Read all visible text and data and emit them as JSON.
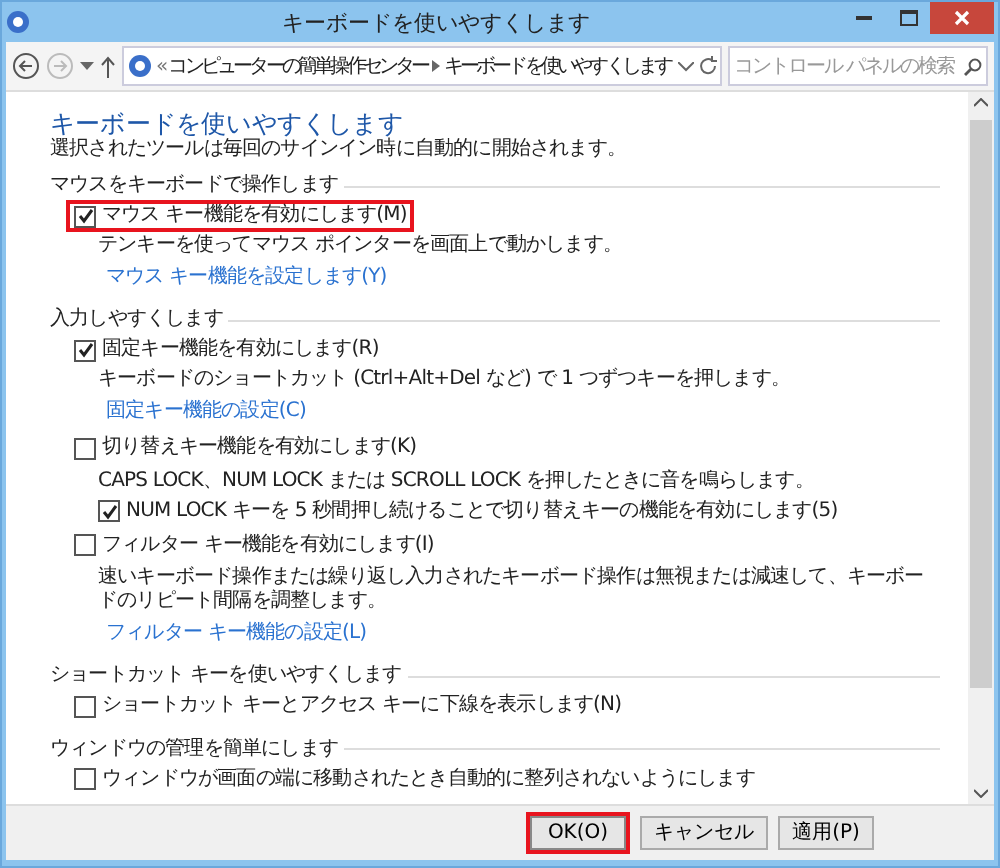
{
  "window": {
    "title": "キーボードを使いやすくします"
  },
  "address_bar": {
    "separator": "«",
    "crumbs": [
      "コンピューターの簡単操作センター",
      "キーボードを使いやすくします"
    ]
  },
  "search": {
    "placeholder": "コントロール パネルの検索"
  },
  "heading": "キーボードを使いやすくします",
  "subtitle": "選択されたツールは毎回のサインイン時に自動的に開始されます。",
  "sections": [
    {
      "title": "マウスをキーボードで操作します",
      "items": [
        {
          "label": "マウス キー機能を有効にします(M)",
          "checked": true,
          "highlighted": true,
          "description": "テンキーを使ってマウス ポインターを画面上で動かします。",
          "link": "マウス キー機能を設定します(Y)"
        }
      ]
    },
    {
      "title": "入力しやすくします",
      "items": [
        {
          "label": "固定キー機能を有効にします(R)",
          "checked": true,
          "highlighted": false,
          "description": "キーボードのショートカット (Ctrl+Alt+Del など) で 1 つずつキーを押します。",
          "link": "固定キー機能の設定(C)"
        },
        {
          "label": "切り替えキー機能を有効にします(K)",
          "checked": false,
          "highlighted": false,
          "description": "CAPS LOCK、NUM LOCK または SCROLL LOCK を押したときに音を鳴らします。",
          "children": [
            {
              "label": "NUM LOCK キーを 5 秒間押し続けることで切り替えキーの機能を有効にします(5)",
              "checked": true,
              "highlighted": false
            }
          ]
        },
        {
          "label": "フィルター キー機能を有効にします(I)",
          "checked": false,
          "highlighted": false,
          "description": "速いキーボード操作または繰り返し入力されたキーボード操作は無視または減速して、キーボードのリピート間隔を調整します。",
          "link": "フィルター キー機能の設定(L)"
        }
      ]
    },
    {
      "title": "ショートカット キーを使いやすくします",
      "items": [
        {
          "label": "ショートカット キーとアクセス キーに下線を表示します(N)",
          "checked": false,
          "highlighted": false
        }
      ]
    },
    {
      "title": "ウィンドウの管理を簡単にします",
      "items": [
        {
          "label": "ウィンドウが画面の端に移動されたとき自動的に整列されないようにします",
          "checked": false,
          "highlighted": false
        }
      ]
    }
  ],
  "buttons": [
    {
      "label": "OK(O)",
      "highlighted": true
    },
    {
      "label": "キャンセル",
      "highlighted": false
    },
    {
      "label": "適用(P)",
      "highlighted": false
    }
  ]
}
